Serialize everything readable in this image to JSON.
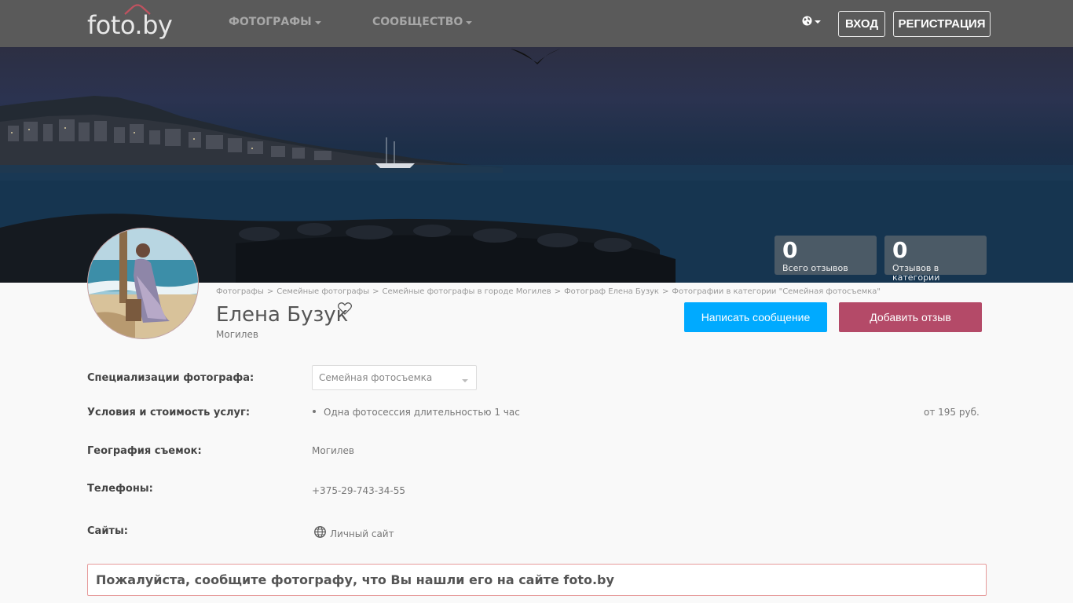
{
  "header": {
    "logo_text": "foto.by",
    "nav": [
      {
        "label": "Фотографы"
      },
      {
        "label": "Сообщество"
      }
    ],
    "login_label": "Вход",
    "register_label": "Регистрация"
  },
  "stats": [
    {
      "value": "0",
      "label": "Всего отзывов"
    },
    {
      "value": "0",
      "label": "Отзывов в категории"
    }
  ],
  "breadcrumbs": [
    "Фотографы",
    "Семейные фотографы",
    "Семейные фотографы в городе Могилев",
    "Фотограф Елена Бузук",
    "Фотографии в категории \"Семейная фотосъемка\""
  ],
  "breadcrumb_separator": ">",
  "profile": {
    "name": "Елена Бузук",
    "city": "Могилев",
    "write_message_label": "Написать сообщение",
    "add_review_label": "Добавить отзыв"
  },
  "info": {
    "specialization_label": "Специализации фотографа:",
    "specialization_value": "Семейная фотосъемка",
    "services_label": "Условия и стоимость услуг:",
    "service_name": "Одна фотосессия длительностью 1 час",
    "service_price": "от 195 руб.",
    "geography_label": "География съемок:",
    "geography_value": "Могилев",
    "phones_label": "Телефоны:",
    "phone_value": "+375-29-743-34-55",
    "sites_label": "Сайты:",
    "site_value": "Личный сайт"
  },
  "notice_text": "Пожалуйста, сообщите фотографу, что Вы нашли его на сайте foto.by",
  "colors": {
    "header_bg": "#5a5a5a",
    "message_button": "#00aaff",
    "review_button": "#b44a68",
    "notice_border": "#e69a9a"
  }
}
